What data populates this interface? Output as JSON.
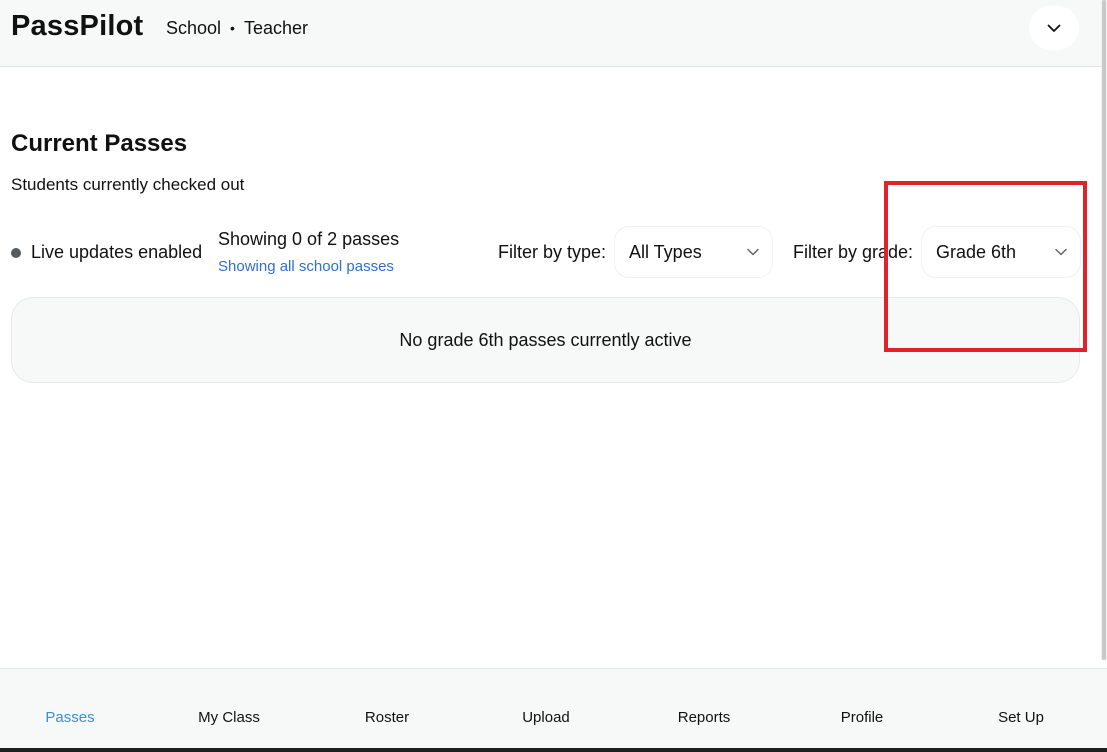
{
  "header": {
    "brand": "PassPilot",
    "school": "School",
    "separator": "•",
    "role": "Teacher",
    "menu_icon": "chevron-down-icon"
  },
  "main": {
    "title": "Current Passes",
    "subtitle": "Students currently checked out",
    "live_status": "Live updates enabled",
    "live_dot_color": "#555b60",
    "showing_text": "Showing 0 of 2 passes",
    "showing_link": "Showing all school passes",
    "filters": {
      "type_label": "Filter by type:",
      "type_value": "All Types",
      "grade_label": "Filter by grade:",
      "grade_value": "Grade 6th"
    },
    "empty_message": "No grade 6th passes currently active"
  },
  "bottom_nav": {
    "items": [
      {
        "label": "Passes",
        "active": true
      },
      {
        "label": "My Class",
        "active": false
      },
      {
        "label": "Roster",
        "active": false
      },
      {
        "label": "Upload",
        "active": false
      },
      {
        "label": "Reports",
        "active": false
      },
      {
        "label": "Profile",
        "active": false
      },
      {
        "label": "Set Up",
        "active": false
      }
    ]
  },
  "colors": {
    "accent": "#3b8fd9",
    "link": "#2f6fd6",
    "highlight": "#e0232a"
  }
}
